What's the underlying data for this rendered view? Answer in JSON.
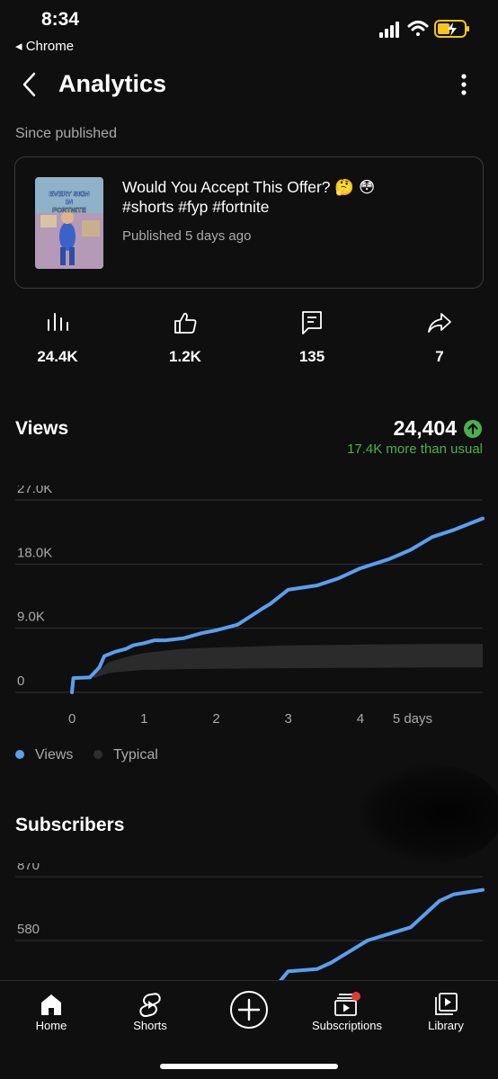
{
  "status_bar": {
    "time": "8:34",
    "back_app": "◂ Chrome"
  },
  "header": {
    "title": "Analytics"
  },
  "since_label": "Since published",
  "video": {
    "thumbnail_text_1": "EVERY SKIN",
    "thumbnail_text_2": "IN",
    "thumbnail_text_3": "FORTNITE",
    "title_line_1": "Would You Accept This Offer? 🤔 😳",
    "title_line_2": "#shorts #fyp #fortnite",
    "published": "Published 5 days ago"
  },
  "stats": [
    {
      "icon": "views-bars-icon",
      "value": "24.4K"
    },
    {
      "icon": "thumbs-up-icon",
      "value": "1.2K"
    },
    {
      "icon": "comment-icon",
      "value": "135"
    },
    {
      "icon": "share-icon",
      "value": "7"
    }
  ],
  "views_section": {
    "title": "Views",
    "total": "24,404",
    "delta": "17.4K more than usual"
  },
  "legend": {
    "views": "Views",
    "typical": "Typical"
  },
  "subscribers_section": {
    "title": "Subscribers"
  },
  "colors": {
    "views_line": "#5a9ff0",
    "typical_band": "#2b2b2b",
    "positive": "#4caf50",
    "badge_red": "#e53935"
  },
  "chart_data": [
    {
      "type": "area",
      "title": "Views",
      "x_tick_labels": [
        "0",
        "1",
        "2",
        "3",
        "4",
        "5 days"
      ],
      "y_tick_labels": [
        "27.0K",
        "18.0K",
        "9.0K",
        "0"
      ],
      "ylim": [
        0,
        27000
      ],
      "xlim": [
        0,
        5.7
      ],
      "grid": true,
      "legend_position": "bottom-left",
      "series": [
        {
          "name": "Views",
          "type": "line",
          "x": [
            0,
            0.02,
            0.25,
            0.38,
            0.45,
            0.6,
            0.75,
            0.85,
            1.0,
            1.15,
            1.3,
            1.55,
            1.8,
            2.0,
            2.3,
            2.65,
            2.75,
            3.0,
            3.4,
            3.7,
            4.0,
            4.4,
            4.7,
            5.0,
            5.3,
            5.5,
            5.7
          ],
          "y": [
            0,
            2000,
            2100,
            3500,
            5100,
            5700,
            6100,
            6600,
            6900,
            7300,
            7300,
            7600,
            8300,
            8700,
            9500,
            11800,
            12400,
            14400,
            15000,
            16000,
            17400,
            18700,
            20000,
            21800,
            22800,
            23600,
            24404
          ]
        },
        {
          "name": "Typical",
          "type": "band",
          "x": [
            0.3,
            0.5,
            0.8,
            1.0,
            1.5,
            2.0,
            3.0,
            4.0,
            5.0,
            5.7
          ],
          "low": [
            2000,
            2700,
            3000,
            3150,
            3250,
            3300,
            3400,
            3450,
            3500,
            3500
          ],
          "high": [
            2300,
            4200,
            5100,
            5500,
            6100,
            6300,
            6600,
            6700,
            6800,
            6800
          ]
        }
      ]
    },
    {
      "type": "line",
      "title": "Subscribers",
      "y_tick_labels": [
        "870",
        "580"
      ],
      "ylim": [
        300,
        870
      ],
      "xlim": [
        0,
        5.7
      ],
      "grid": true,
      "series": [
        {
          "name": "Subscribers",
          "x": [
            2.7,
            2.85,
            3.0,
            3.4,
            3.6,
            3.9,
            4.1,
            4.3,
            4.5,
            4.7,
            4.9,
            5.1,
            5.3,
            5.5,
            5.7
          ],
          "y": [
            300,
            380,
            440,
            450,
            480,
            540,
            580,
            600,
            620,
            640,
            700,
            760,
            790,
            800,
            810
          ]
        }
      ]
    }
  ],
  "nav": [
    {
      "label": "Home",
      "icon": "home-icon"
    },
    {
      "label": "Shorts",
      "icon": "shorts-icon"
    },
    {
      "label": "",
      "icon": "create-plus-icon"
    },
    {
      "label": "Subscriptions",
      "icon": "subscriptions-icon"
    },
    {
      "label": "Library",
      "icon": "library-icon"
    }
  ]
}
